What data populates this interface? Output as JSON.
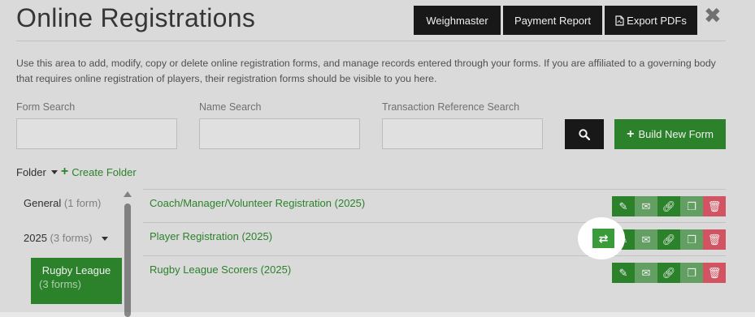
{
  "page": {
    "title": "Online Registrations",
    "close_symbol": "✖"
  },
  "toolbar": {
    "weighmaster": "Weighmaster",
    "payment_report": "Payment Report",
    "export_pdfs": "Export PDFs"
  },
  "description": "Use this area to add, modify, copy or delete online registration forms, and manage records entered through your forms. If you are affiliated to a governing body that requires online registration of players, their registration forms should be visible to you here.",
  "search": {
    "form_label": "Form Search",
    "name_label": "Name Search",
    "txn_label": "Transaction Reference Search",
    "form_value": "",
    "name_value": "",
    "txn_value": "",
    "build_label": "Build New Form"
  },
  "folders": {
    "label": "Folder",
    "create_label": "Create Folder",
    "items": [
      {
        "name": "General",
        "count": "(1 form)"
      },
      {
        "name": "2025",
        "count": "(3 forms)"
      }
    ],
    "selected": {
      "name": "Rugby League",
      "count": "(3 forms)"
    }
  },
  "forms": [
    {
      "name": "Coach/Manager/Volunteer Registration (2025)"
    },
    {
      "name": "Player Registration (2025)"
    },
    {
      "name": "Rugby League Scorers (2025)"
    }
  ],
  "icons": {
    "edit": "pencil-icon",
    "email": "envelope-icon",
    "link": "link-icon",
    "copy": "copy-icon",
    "delete": "trash-icon",
    "transfer": "transfer-icon",
    "search": "search-icon",
    "pdf": "pdf-icon"
  },
  "colors": {
    "accent_green": "#2e8b2e",
    "dark_button": "#1a1a1a",
    "delete_red": "#e05a6a"
  }
}
